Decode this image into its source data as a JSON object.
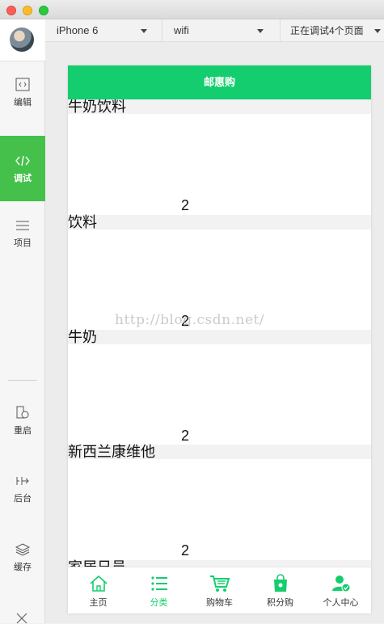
{
  "toolbar": {
    "device": "iPhone 6",
    "network": "wifi",
    "debug_status": "正在调试4个页面"
  },
  "sidebar": {
    "items": [
      {
        "label": "编辑",
        "icon": "code-file-icon"
      },
      {
        "label": "调试",
        "icon": "code-icon"
      },
      {
        "label": "项目",
        "icon": "menu-icon"
      },
      {
        "label": "重启",
        "icon": "restart-icon"
      },
      {
        "label": "后台",
        "icon": "background-icon"
      },
      {
        "label": "缓存",
        "icon": "layers-icon"
      }
    ]
  },
  "app": {
    "nav_title": "邮惠购",
    "sections": [
      {
        "title": "牛奶饮料",
        "count": "2"
      },
      {
        "title": "饮料",
        "count": "2"
      },
      {
        "title": "牛奶",
        "count": "2"
      },
      {
        "title": "新西兰康维他",
        "count": "2"
      },
      {
        "title": "家居日员"
      }
    ],
    "tabs": [
      {
        "label": "主页",
        "icon": "home-icon"
      },
      {
        "label": "分类",
        "icon": "list-icon"
      },
      {
        "label": "购物车",
        "icon": "cart-icon"
      },
      {
        "label": "积分购",
        "icon": "bag-icon"
      },
      {
        "label": "个人中心",
        "icon": "user-icon"
      }
    ],
    "active_tab": "分类"
  },
  "watermark": "http://blog.csdn.net/",
  "colors": {
    "accent": "#14cd6e",
    "sidebar_active": "#45c14b"
  }
}
